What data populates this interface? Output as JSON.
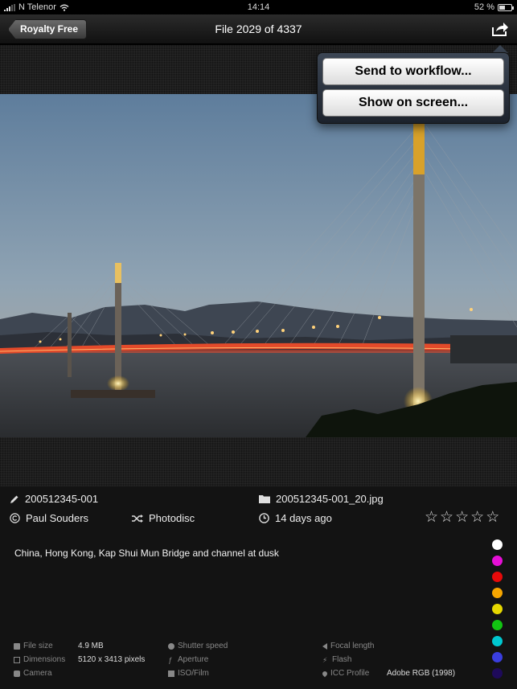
{
  "status_bar": {
    "carrier": "N Telenor",
    "time": "14:14",
    "battery": "52 %",
    "battery_level": 0.52
  },
  "nav": {
    "back_label": "Royalty Free",
    "title": "File 2029 of 4337"
  },
  "popover": {
    "send_label": "Send to workflow...",
    "show_label": "Show on screen..."
  },
  "info": {
    "id": "200512345-001",
    "filename": "200512345-001_20.jpg",
    "photographer": "Paul Souders",
    "collection": "Photodisc",
    "age": "14 days ago",
    "rating": 0,
    "rating_max": 5,
    "description": "China, Hong Kong, Kap Shui Mun Bridge and channel at dusk"
  },
  "color_labels": [
    "#ffffff",
    "#e60fd6",
    "#e60a0a",
    "#f7a600",
    "#e6d800",
    "#12c412",
    "#00c8d0",
    "#3a3ee0",
    "#1e0a5a"
  ],
  "exif": {
    "file_size_label": "File size",
    "file_size": "4.9 MB",
    "dimensions_label": "Dimensions",
    "dimensions": "5120 x 3413 pixels",
    "camera_label": "Camera",
    "shutter_label": "Shutter speed",
    "aperture_label": "Aperture",
    "iso_label": "ISO/Film",
    "focal_label": "Focal length",
    "flash_label": "Flash",
    "icc_label": "ICC Profile",
    "icc": "Adobe RGB (1998)"
  }
}
